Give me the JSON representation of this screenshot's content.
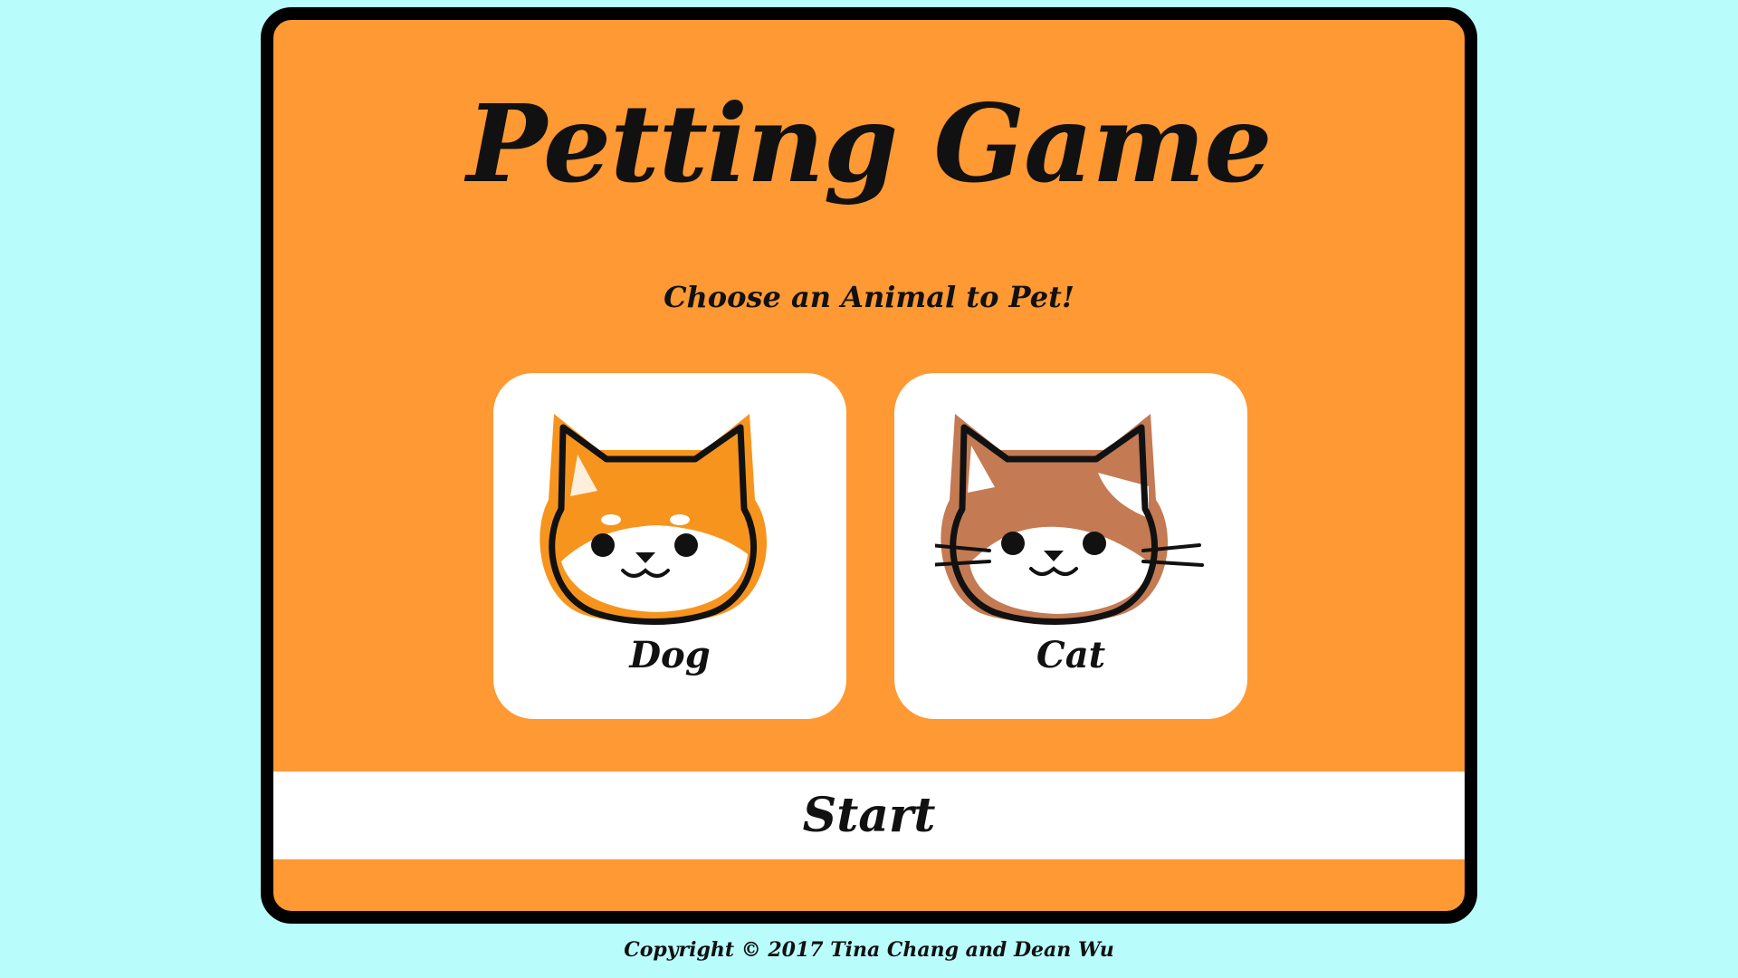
{
  "page": {
    "background_color": "#b9fcfc",
    "panel_color": "#ff9933"
  },
  "header": {
    "title": "Petting Game",
    "subtitle": "Choose an Animal to Pet!"
  },
  "animals": [
    {
      "label": "Dog",
      "icon": "shiba-dog-face-icon",
      "fur_color": "#f7941d"
    },
    {
      "label": "Cat",
      "icon": "cat-face-icon",
      "fur_color": "#c47a52"
    }
  ],
  "start_button": {
    "label": "Start"
  },
  "footer": {
    "text": "Copyright © 2017 Tina Chang and Dean Wu"
  }
}
